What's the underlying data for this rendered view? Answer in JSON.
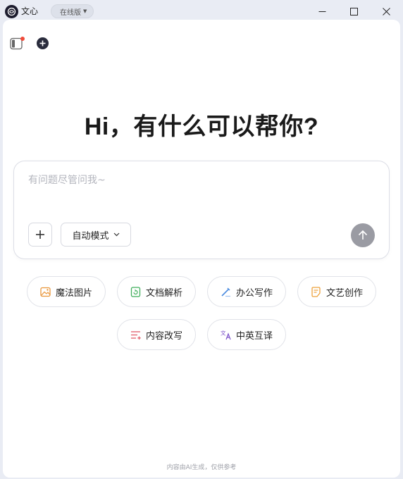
{
  "titlebar": {
    "app_title": "文心",
    "edition": "在线版",
    "logo_icon": "wenxin-logo-icon"
  },
  "toolbar": {
    "sidebar_icon": "sidebar-toggle-icon",
    "new_chat_icon": "plus-circle-icon",
    "notification_color": "#f04a3a"
  },
  "main": {
    "greeting": "Hi，有什么可以帮你?",
    "input_placeholder": "有问题尽管问我~",
    "mode_label": "自动模式"
  },
  "quick_actions": [
    {
      "label": "魔法图片",
      "icon": "image-icon",
      "color": "#e9963a"
    },
    {
      "label": "文档解析",
      "icon": "document-refresh-icon",
      "color": "#3fae5b"
    },
    {
      "label": "办公写作",
      "icon": "pen-icon",
      "color": "#4a8be0"
    },
    {
      "label": "文艺创作",
      "icon": "note-icon",
      "color": "#eda23c"
    },
    {
      "label": "内容改写",
      "icon": "list-edit-icon",
      "color": "#e25c6a"
    },
    {
      "label": "中英互译",
      "icon": "translate-icon",
      "color": "#7a4fc9"
    }
  ],
  "footer": {
    "note": "内容由AI生成，仅供参考"
  }
}
